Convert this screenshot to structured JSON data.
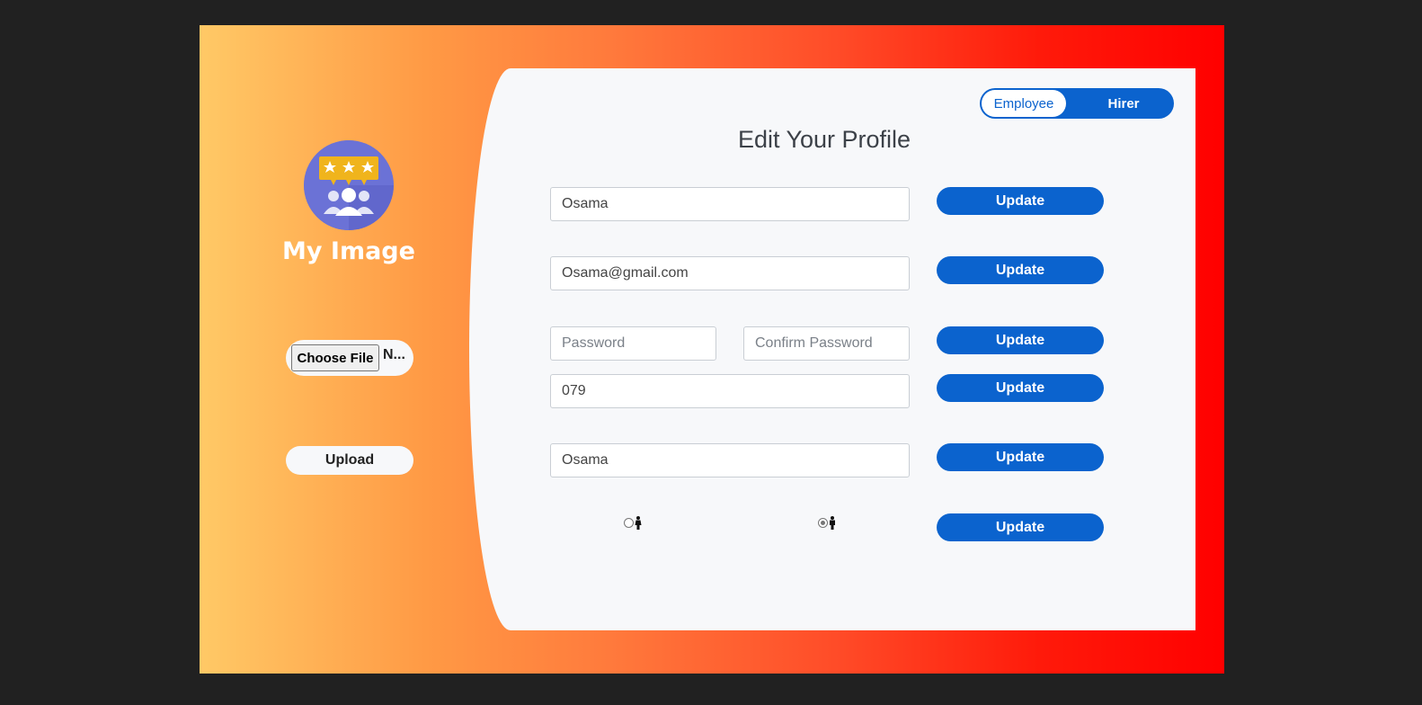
{
  "sidebar": {
    "avatar_icon": "group-rating-icon",
    "title": "My Image",
    "choose_file_label": "Choose File",
    "file_status": "N...",
    "upload_label": "Upload"
  },
  "toggle": {
    "employee_label": "Employee",
    "hirer_label": "Hirer",
    "active": "Employee"
  },
  "form": {
    "title": "Edit Your Profile",
    "name_value": "Osama",
    "email_value": "Osama@gmail.com",
    "password_placeholder": "Password",
    "confirm_password_placeholder": "Confirm Password",
    "phone_value": "079",
    "last_name_value": "Osama",
    "gender": {
      "options": [
        {
          "icon": "female-person-icon",
          "checked": false
        },
        {
          "icon": "male-person-icon",
          "checked": true
        }
      ]
    },
    "update_label": "Update"
  },
  "colors": {
    "accent": "#0b63ce",
    "gradient_start": "#ffc966",
    "gradient_end": "#ff0000",
    "page_bg": "#212121",
    "panel_bg": "#f7f8fa"
  }
}
